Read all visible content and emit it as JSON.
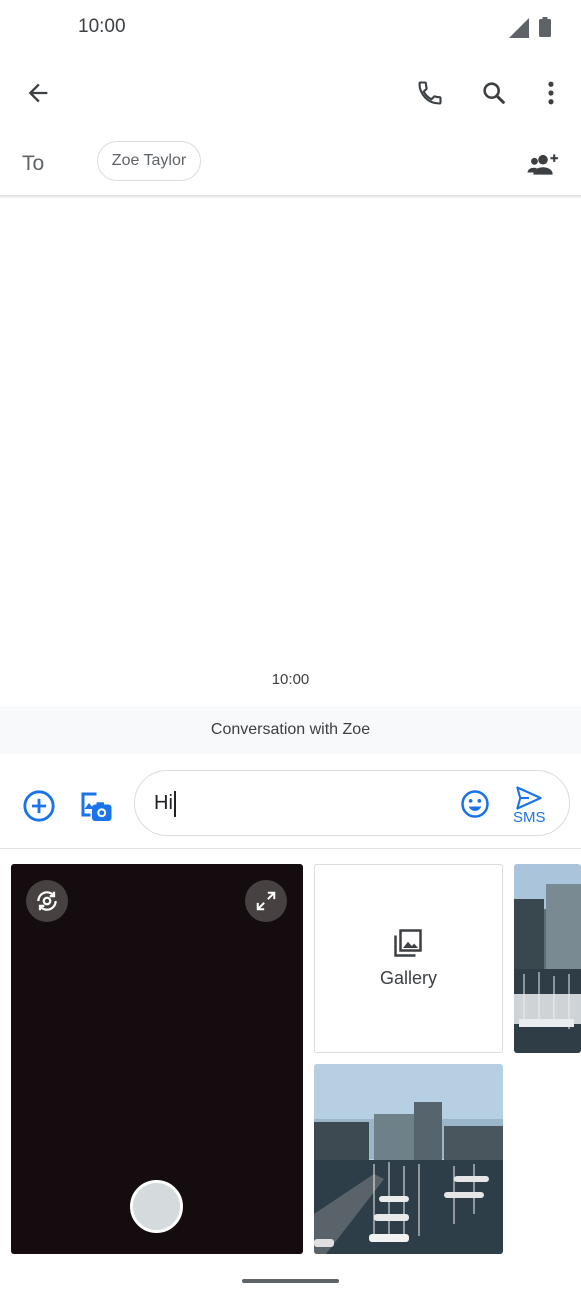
{
  "status_bar": {
    "time": "10:00"
  },
  "toolbar": {
    "back_icon": "arrow-back-icon",
    "call_icon": "phone-icon",
    "search_icon": "search-icon",
    "more_icon": "more-vert-icon"
  },
  "recipients": {
    "to_label": "To",
    "chips": [
      "Zoe Taylor"
    ],
    "add_icon": "add-people-icon"
  },
  "conversation": {
    "timestamp": "10:00",
    "banner": "Conversation with Zoe"
  },
  "composer": {
    "text": "Hi",
    "send_label": "SMS",
    "accent_color": "#1a73e8"
  },
  "media_picker": {
    "gallery_label": "Gallery"
  }
}
